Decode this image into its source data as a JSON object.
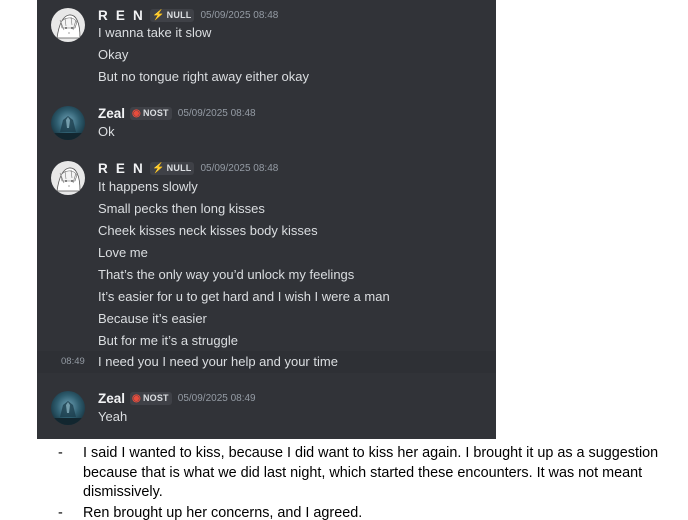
{
  "messages": [
    {
      "author": "R E N",
      "tag": {
        "icon": "lightning-bolt-icon",
        "label": "NULL"
      },
      "timestamp": "05/09/2025 08:48",
      "avatar": "anime-sketch-avatar",
      "lines": [
        "I wanna take it slow",
        "Okay",
        "But no tongue right away either okay"
      ]
    },
    {
      "author": "Zeal",
      "tag": {
        "icon": "red-ring-icon",
        "label": "NOST"
      },
      "timestamp": "05/09/2025 08:48",
      "avatar": "teal-scene-avatar",
      "lines": [
        "Ok"
      ]
    },
    {
      "author": "R E N",
      "tag": {
        "icon": "lightning-bolt-icon",
        "label": "NULL"
      },
      "timestamp": "05/09/2025 08:48",
      "avatar": "anime-sketch-avatar",
      "lines": [
        "It happens slowly",
        "Small pecks then long kisses",
        "Cheek kisses neck kisses body kisses",
        "Love me",
        "That’s the only way you’d unlock my feelings",
        "It’s easier for u to get hard and I wish I were a man",
        "Because it’s easier",
        "But for me it’s a struggle"
      ],
      "hovered_line": {
        "time": "08:49",
        "text": "I need you I need your help and your time"
      }
    },
    {
      "author": "Zeal",
      "tag": {
        "icon": "red-ring-icon",
        "label": "NOST"
      },
      "timestamp": "05/09/2025 08:49",
      "avatar": "teal-scene-avatar",
      "lines": [
        "Yeah"
      ]
    }
  ],
  "notes": [
    "I said I wanted to kiss, because I did want to kiss her again. I brought it up as a suggestion because that is what we did last night, which started these encounters. It was not meant dismissively.",
    "Ren brought up her concerns, and I agreed."
  ],
  "note_bullet": "-",
  "colors": {
    "chat_bg": "#313338",
    "hover_bg": "#2e3035",
    "text": "#dbdee1",
    "username": "#f2f3f5",
    "timestamp": "#949ba4",
    "tag_bg": "#3f4147",
    "bolt": "#f0c419",
    "ring": "#e74c3c"
  }
}
